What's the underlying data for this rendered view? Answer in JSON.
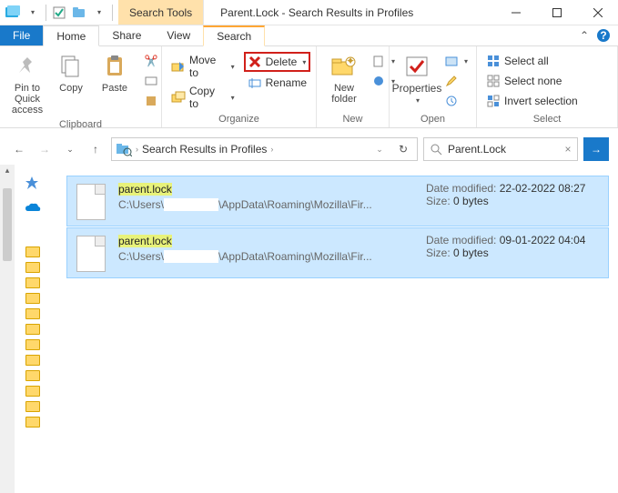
{
  "titlebar": {
    "search_tools": "Search Tools",
    "title": "Parent.Lock - Search Results in Profiles"
  },
  "tabs": {
    "file": "File",
    "home": "Home",
    "share": "Share",
    "view": "View",
    "search": "Search"
  },
  "ribbon": {
    "clipboard": {
      "label": "Clipboard",
      "pin": "Pin to Quick\naccess",
      "copy": "Copy",
      "paste": "Paste"
    },
    "organize": {
      "label": "Organize",
      "moveto": "Move to",
      "copyto": "Copy to",
      "delete": "Delete",
      "rename": "Rename"
    },
    "new_": {
      "label": "New",
      "newfolder": "New\nfolder"
    },
    "open_": {
      "label": "Open",
      "properties": "Properties"
    },
    "select_": {
      "label": "Select",
      "all": "Select all",
      "none": "Select none",
      "invert": "Invert selection"
    }
  },
  "address": {
    "crumb": "Search Results in Profiles",
    "search_value": "Parent.Lock"
  },
  "results": [
    {
      "name_pre": "parent",
      "name_hl": ".lock",
      "path_a": "C:\\Users\\",
      "path_b": "\\AppData\\Roaming\\Mozilla\\Fir...",
      "mod_k": "Date modified:",
      "mod_v": "22-02-2022 08:27",
      "size_k": "Size:",
      "size_v": "0 bytes"
    },
    {
      "name_pre": "parent",
      "name_hl": ".lock",
      "path_a": "C:\\Users\\",
      "path_b": "\\AppData\\Roaming\\Mozilla\\Fir...",
      "mod_k": "Date modified:",
      "mod_v": "09-01-2022 04:04",
      "size_k": "Size:",
      "size_v": "0 bytes"
    }
  ]
}
